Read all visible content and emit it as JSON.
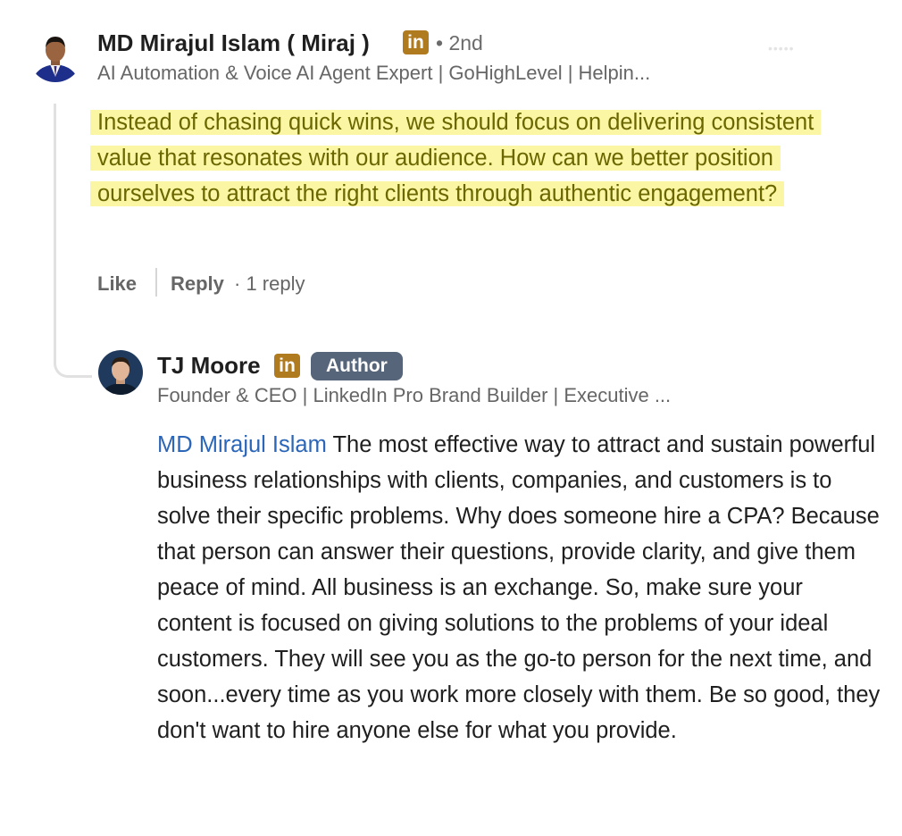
{
  "comment": {
    "author_name": "MD Mirajul Islam ( Miraj )",
    "degree": "• 2nd",
    "headline": "AI Automation & Voice AI Agent Expert | GoHighLevel | Helpin...",
    "text": " Instead of chasing quick wins, we should focus on delivering consistent value that resonates with our audience. How can we better position ourselves to attract the right clients through authentic engagement?",
    "actions": {
      "like": "Like",
      "reply": "Reply",
      "reply_count": "· 1 reply"
    }
  },
  "reply": {
    "author_name": "TJ Moore",
    "badge": "Author",
    "headline": "Founder & CEO | LinkedIn Pro Brand Builder | Executive ...",
    "mention": "MD Mirajul Islam",
    "text": " The most effective way to attract and sustain powerful business relationships with clients, companies, and customers is to solve their specific problems. Why does someone hire a CPA? Because that person can answer their questions, provide clarity, and give them peace of mind. All business is an exchange. So, make sure your content is focused on giving solutions to the problems of your ideal customers. They will see you as the go-to person for the next time, and soon...every time as you work more closely with them. Be so good, they don't want to hire anyone else for what you provide."
  },
  "icons": {
    "linkedin_badge": "in",
    "linkedin_color": "#b07a1f"
  },
  "colors": {
    "highlight": "#fbf6a3",
    "mention": "#2b66b8",
    "author_badge": "#56657a"
  }
}
